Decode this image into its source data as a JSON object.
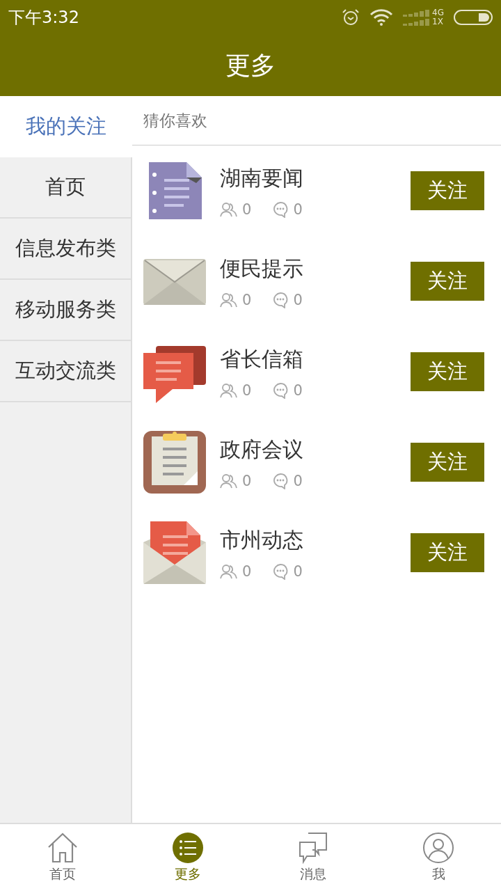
{
  "status_bar": {
    "time": "下午3:32",
    "network_top": "4G",
    "network_bottom": "1X"
  },
  "header": {
    "title": "更多"
  },
  "sidebar": {
    "items": [
      {
        "label": "我的关注",
        "selected": true
      },
      {
        "label": "首页",
        "selected": false
      },
      {
        "label": "信息发布类",
        "selected": false
      },
      {
        "label": "移动服务类",
        "selected": false
      },
      {
        "label": "互动交流类",
        "selected": false
      }
    ]
  },
  "section": {
    "title": "猜你喜欢"
  },
  "channels": [
    {
      "kind": "document",
      "name": "湖南要闻",
      "followers": "0",
      "comments": "0",
      "button": "关注"
    },
    {
      "kind": "envelope",
      "name": "便民提示",
      "followers": "0",
      "comments": "0",
      "button": "关注"
    },
    {
      "kind": "chat",
      "name": "省长信箱",
      "followers": "0",
      "comments": "0",
      "button": "关注"
    },
    {
      "kind": "clipboard",
      "name": "政府会议",
      "followers": "0",
      "comments": "0",
      "button": "关注"
    },
    {
      "kind": "letter",
      "name": "市州动态",
      "followers": "0",
      "comments": "0",
      "button": "关注"
    }
  ],
  "bottom_nav": [
    {
      "kind": "home",
      "label": "首页",
      "selected": false
    },
    {
      "kind": "list",
      "label": "更多",
      "selected": true
    },
    {
      "kind": "messages",
      "label": "消息",
      "selected": false
    },
    {
      "kind": "profile",
      "label": "我",
      "selected": false
    }
  ]
}
